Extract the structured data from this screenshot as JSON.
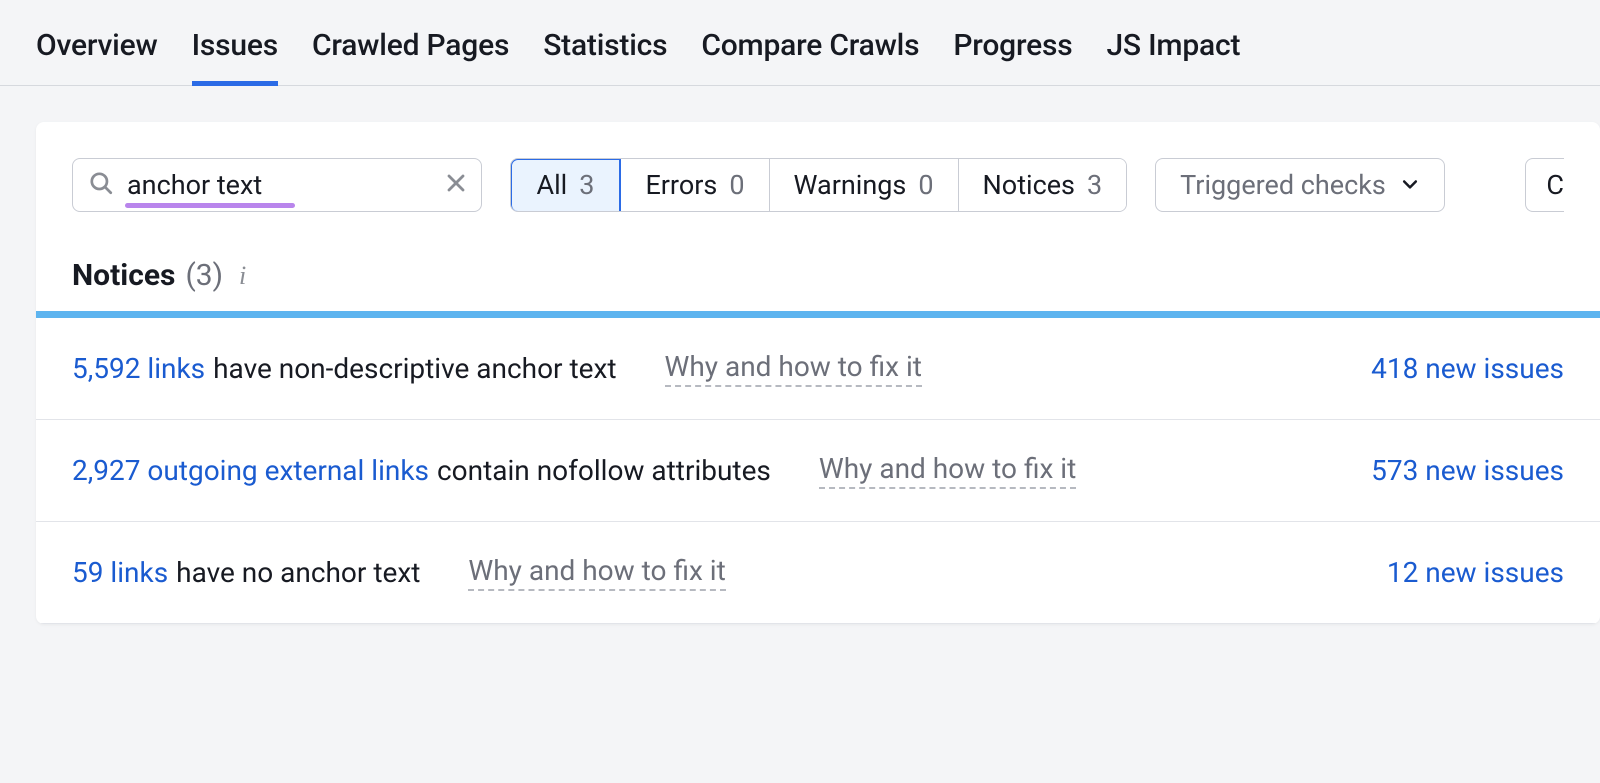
{
  "tabs": {
    "overview": "Overview",
    "issues": "Issues",
    "crawled_pages": "Crawled Pages",
    "statistics": "Statistics",
    "compare_crawls": "Compare Crawls",
    "progress": "Progress",
    "js_impact": "JS Impact"
  },
  "search": {
    "value": "anchor text"
  },
  "filters": {
    "all": {
      "label": "All",
      "count": "3"
    },
    "errors": {
      "label": "Errors",
      "count": "0"
    },
    "warnings": {
      "label": "Warnings",
      "count": "0"
    },
    "notices": {
      "label": "Notices",
      "count": "3"
    }
  },
  "dropdown": {
    "triggered_checks": "Triggered checks"
  },
  "cut_button": "C",
  "section": {
    "title": "Notices",
    "count": "(3)"
  },
  "fix_label": "Why and how to fix it",
  "issues": [
    {
      "link": "5,592 links",
      "desc": "have non-descriptive anchor text",
      "new": "418 new issues"
    },
    {
      "link": "2,927 outgoing external links",
      "desc": "contain nofollow attributes",
      "new": "573 new issues"
    },
    {
      "link": "59 links",
      "desc": "have no anchor text",
      "new": "12 new issues"
    }
  ]
}
